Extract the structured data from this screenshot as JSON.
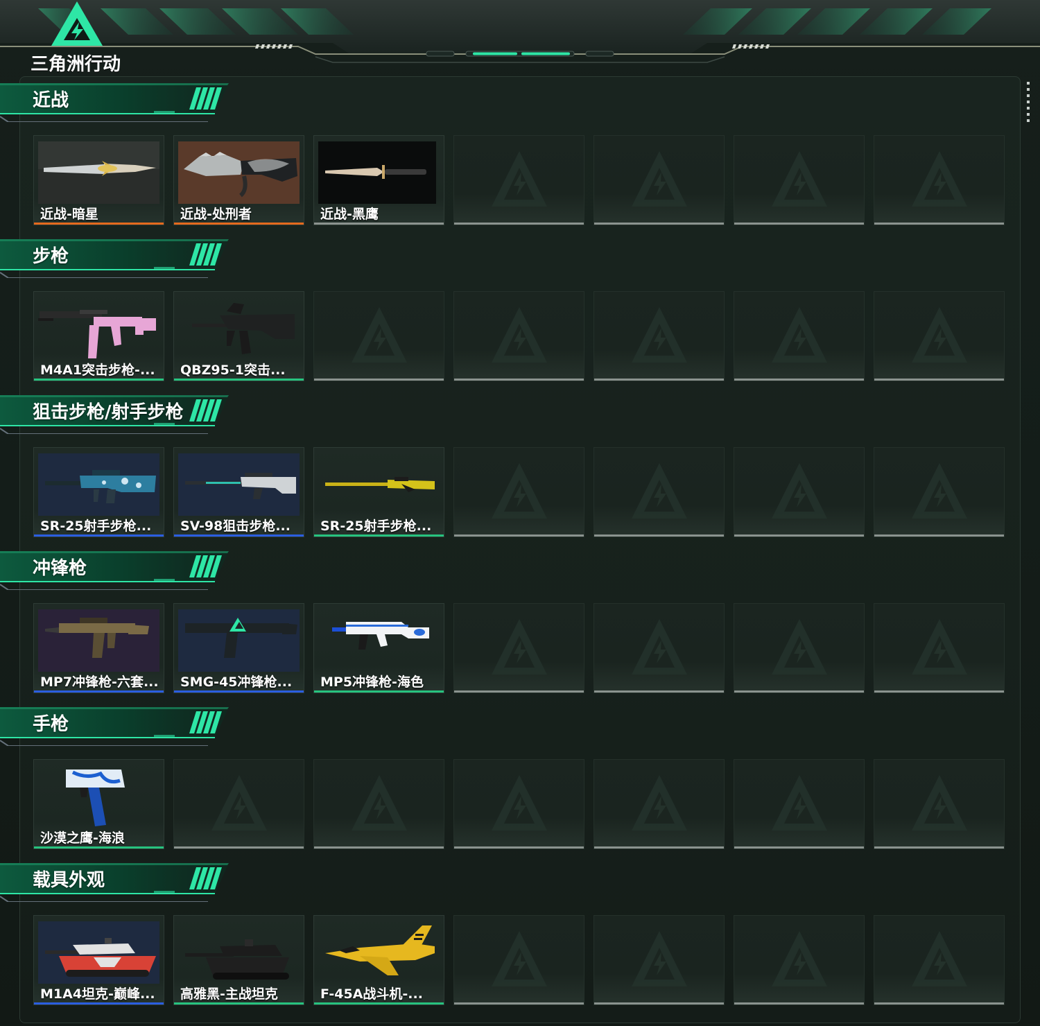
{
  "app": {
    "logo_text": "三角洲行动"
  },
  "colors": {
    "accent": "#2ee6a6",
    "rarity_orange": "#e56a1e",
    "rarity_green": "#27c37f",
    "rarity_blue": "#2b5ee0",
    "rarity_gray": "#8b938f"
  },
  "sections": [
    {
      "title": "近战",
      "items": [
        {
          "label": "近战-暗星",
          "rarity": "orange",
          "icon": "knife-darkstar"
        },
        {
          "label": "近战-处刑者",
          "rarity": "orange",
          "icon": "knife-executioner"
        },
        {
          "label": "近战-黑鹰",
          "rarity": "gray",
          "icon": "knife-blackhawk"
        },
        {
          "label": "",
          "rarity": "empty"
        },
        {
          "label": "",
          "rarity": "empty"
        },
        {
          "label": "",
          "rarity": "empty"
        },
        {
          "label": "",
          "rarity": "empty"
        }
      ]
    },
    {
      "title": "步枪",
      "items": [
        {
          "label": "M4A1突击步枪-...",
          "rarity": "green",
          "icon": "rifle-pink"
        },
        {
          "label": "QBZ95-1突击...",
          "rarity": "green",
          "icon": "rifle-black"
        },
        {
          "label": "",
          "rarity": "empty"
        },
        {
          "label": "",
          "rarity": "empty"
        },
        {
          "label": "",
          "rarity": "empty"
        },
        {
          "label": "",
          "rarity": "empty"
        },
        {
          "label": "",
          "rarity": "empty"
        }
      ]
    },
    {
      "title": "狙击步枪/射手步枪",
      "items": [
        {
          "label": "SR-25射手步枪...",
          "rarity": "blue",
          "icon": "dmr-blue-camo"
        },
        {
          "label": "SV-98狙击步枪...",
          "rarity": "blue",
          "icon": "sniper-teal"
        },
        {
          "label": "SR-25射手步枪...",
          "rarity": "green",
          "icon": "dmr-yellow"
        },
        {
          "label": "",
          "rarity": "empty"
        },
        {
          "label": "",
          "rarity": "empty"
        },
        {
          "label": "",
          "rarity": "empty"
        },
        {
          "label": "",
          "rarity": "empty"
        }
      ]
    },
    {
      "title": "冲锋枪",
      "items": [
        {
          "label": "MP7冲锋枪-六套...",
          "rarity": "blue",
          "icon": "smg-camo"
        },
        {
          "label": "SMG-45冲锋枪...",
          "rarity": "blue",
          "icon": "smg-green-logo"
        },
        {
          "label": "MP5冲锋枪-海色",
          "rarity": "green",
          "icon": "smg-white-blue"
        },
        {
          "label": "",
          "rarity": "empty"
        },
        {
          "label": "",
          "rarity": "empty"
        },
        {
          "label": "",
          "rarity": "empty"
        },
        {
          "label": "",
          "rarity": "empty"
        }
      ]
    },
    {
      "title": "手枪",
      "items": [
        {
          "label": "沙漠之鹰-海浪",
          "rarity": "green",
          "icon": "pistol-wave"
        },
        {
          "label": "",
          "rarity": "empty"
        },
        {
          "label": "",
          "rarity": "empty"
        },
        {
          "label": "",
          "rarity": "empty"
        },
        {
          "label": "",
          "rarity": "empty"
        },
        {
          "label": "",
          "rarity": "empty"
        },
        {
          "label": "",
          "rarity": "empty"
        }
      ]
    },
    {
      "title": "载具外观",
      "items": [
        {
          "label": "M1A4坦克-巅峰...",
          "rarity": "blue",
          "icon": "tank-red"
        },
        {
          "label": "高雅黑-主战坦克",
          "rarity": "green",
          "icon": "tank-black"
        },
        {
          "label": "F-45A战斗机-...",
          "rarity": "green",
          "icon": "jet-yellow"
        },
        {
          "label": "",
          "rarity": "empty"
        },
        {
          "label": "",
          "rarity": "empty"
        },
        {
          "label": "",
          "rarity": "empty"
        },
        {
          "label": "",
          "rarity": "empty"
        }
      ]
    }
  ]
}
